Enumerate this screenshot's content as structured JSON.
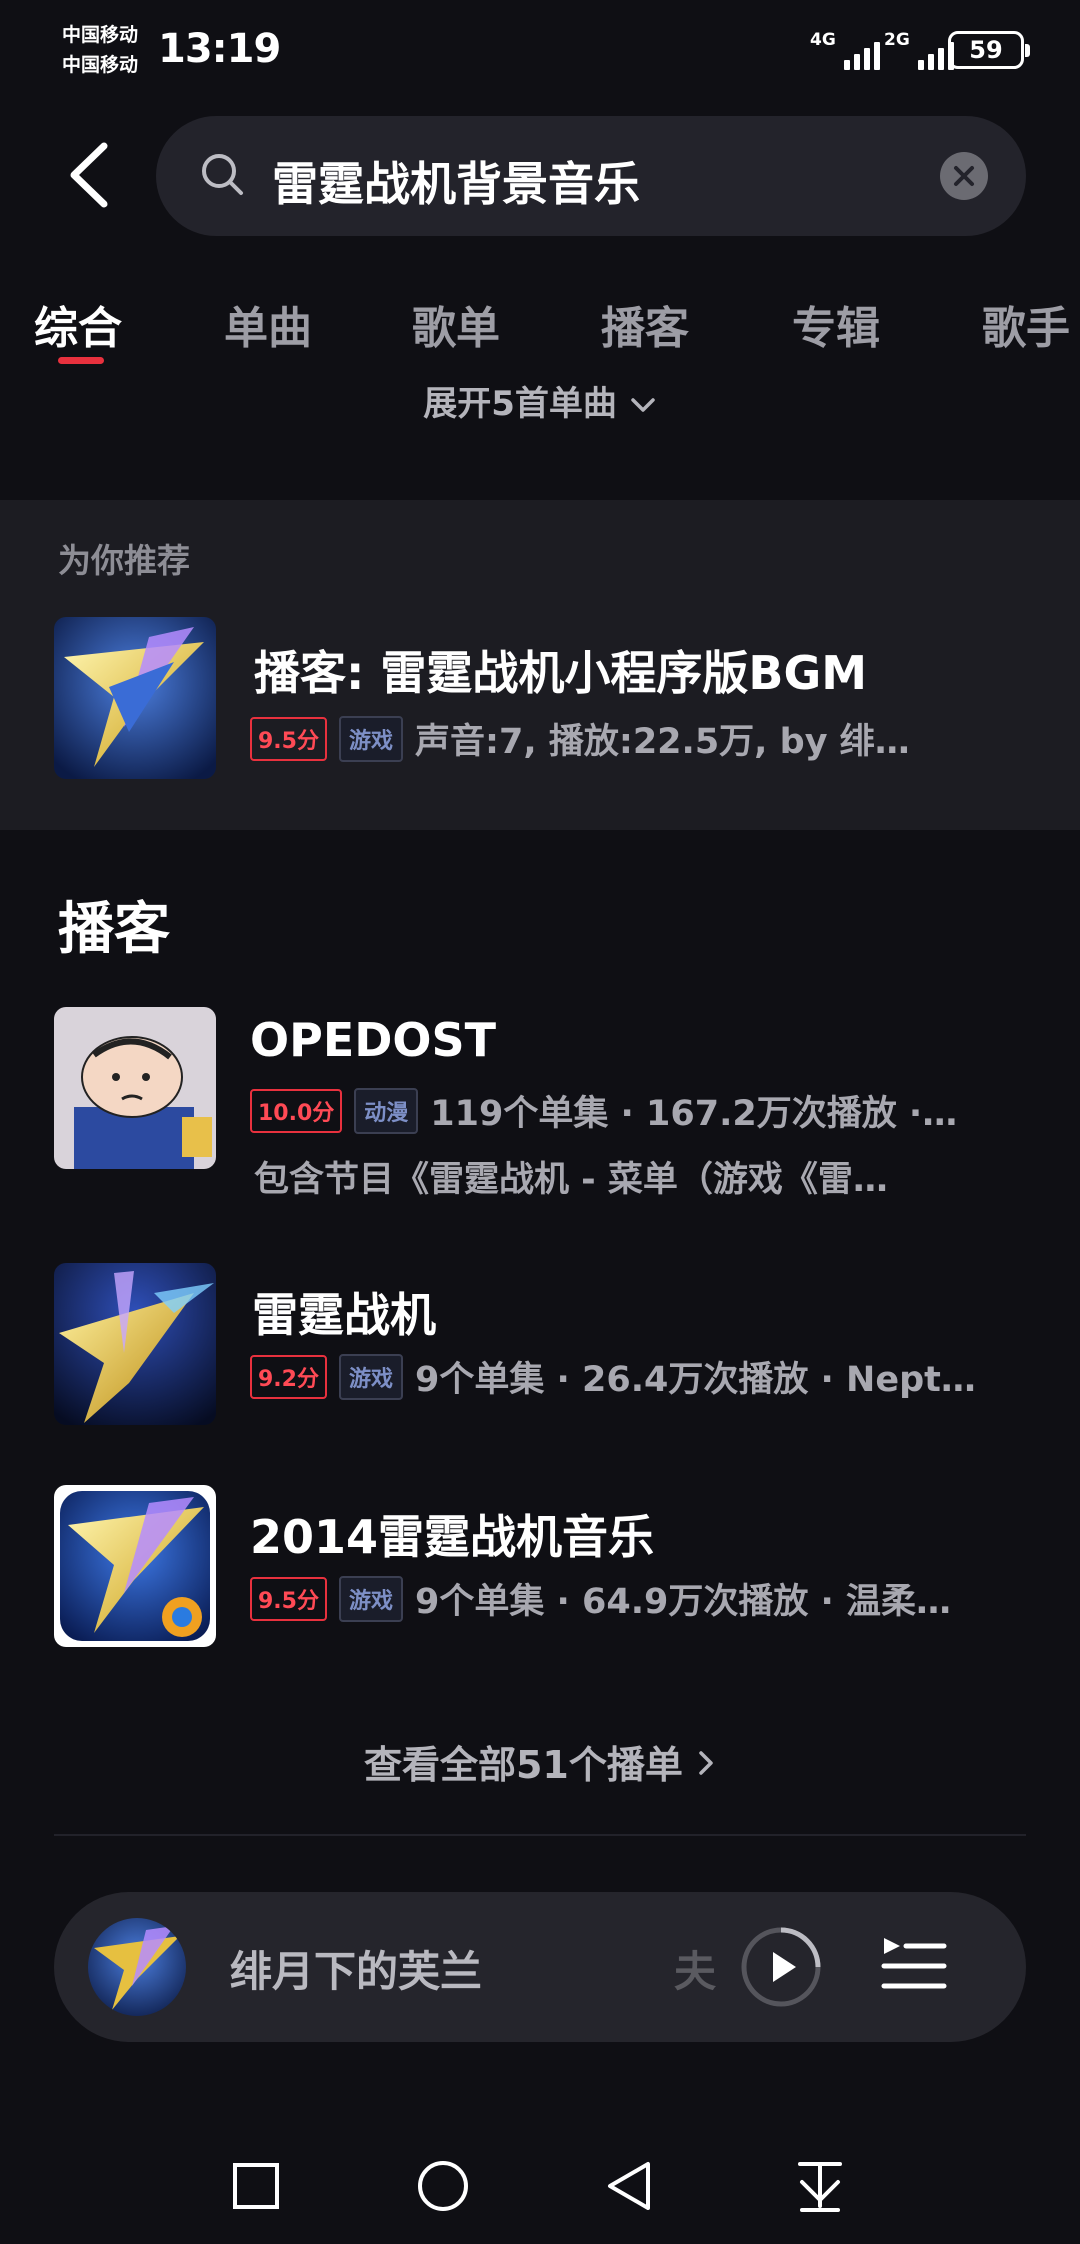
{
  "status_bar": {
    "carrier_1": "中国移动",
    "carrier_2": "中国移动",
    "time": "13:19",
    "net_1": "4G",
    "net_2": "2G",
    "battery": "59"
  },
  "search": {
    "query": "雷霆战机背景音乐"
  },
  "tabs": [
    {
      "label": "综合",
      "active": true
    },
    {
      "label": "单曲"
    },
    {
      "label": "歌单"
    },
    {
      "label": "播客"
    },
    {
      "label": "专辑"
    },
    {
      "label": "歌手"
    }
  ],
  "expand_label": "展开5首单曲",
  "recommend": {
    "heading": "为你推荐",
    "item": {
      "title": "播客: 雷霆战机小程序版BGM",
      "score": "9.5分",
      "tag": "游戏",
      "meta": "声音:7, 播放:22.5万, by 绯…"
    }
  },
  "podcasts": {
    "heading": "播客",
    "items": [
      {
        "title": "OPEDOST",
        "score": "10.0分",
        "tag": "动漫",
        "meta": "119个单集 · 167.2万次播放 ·…",
        "desc": "包含节目《雷霆战机 - 菜单（游戏《雷…"
      },
      {
        "title": "雷霆战机",
        "score": "9.2分",
        "tag": "游戏",
        "meta": "9个单集 · 26.4万次播放 · Nept…"
      },
      {
        "title": "2014雷霆战机音乐",
        "score": "9.5分",
        "tag": "游戏",
        "meta": "9个单集 · 64.9万次播放 · 温柔…"
      }
    ],
    "view_all": "查看全部51个播单"
  },
  "player": {
    "title": "绯月下的芙兰",
    "ghost_char": "夫"
  },
  "colors": {
    "accent": "#e8313e",
    "background": "#0f0f14",
    "panel": "#1c1c22"
  }
}
